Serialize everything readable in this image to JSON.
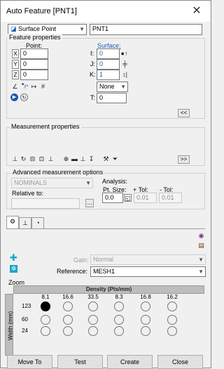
{
  "window": {
    "title": "Auto Feature [PNT1]",
    "close_glyph": "✕"
  },
  "feature": {
    "type": "Surface Point",
    "name": "PNT1"
  },
  "feature_properties": {
    "label": "Feature properties",
    "point_label": "Point:",
    "surface_label": "Surface:",
    "point": {
      "x_label": "X",
      "y_label": "Y",
      "z_label": "Z",
      "x": "0",
      "y": "0",
      "z": "0"
    },
    "surface": {
      "i_label": "I:",
      "j_label": "J:",
      "k_label": "K:",
      "i": "0",
      "j": "0",
      "k": "1"
    },
    "none_option": "None",
    "t_label": "T:",
    "t_value": "0",
    "collapse_button": "<<"
  },
  "measurement_properties": {
    "label": "Measurement properties",
    "expand_button": ">>"
  },
  "advanced": {
    "label": "Advanced measurement options",
    "nominals_select": "NOMINALS",
    "relative_to_label": "Relative to:",
    "relative_to_value": "",
    "browse_button": "...",
    "analysis_label": "Analysis:",
    "pt_size_label": "Pt. Size:",
    "plus_tol_label": "+ Tol:",
    "minus_tol_label": "- Tol:",
    "pt_size_value": "0.0",
    "plus_tol_value": "0.01",
    "minus_tol_value": "0.01"
  },
  "settings": {
    "gain_label": "Gain:",
    "gain_value": "Normal",
    "reference_label": "Reference:",
    "reference_value": "MESH1",
    "zoom_label": "Zoom"
  },
  "density_grid": {
    "header": "Density (Pts/mm)",
    "side_label": "Width (mm)",
    "columns": [
      "8.1",
      "16.6",
      "33.5",
      "8.3",
      "16.8",
      "16.2"
    ],
    "rows": [
      "123",
      "60",
      "24"
    ],
    "selected": {
      "row": 0,
      "col": 0
    }
  },
  "footer": {
    "move_to": "Move To",
    "test": "Test",
    "create": "Create",
    "close": "Close"
  },
  "colors": {
    "accent": "#1c5bb4",
    "grid_header": "#bdbdbd",
    "teal_icon": "#1aa4c8"
  }
}
